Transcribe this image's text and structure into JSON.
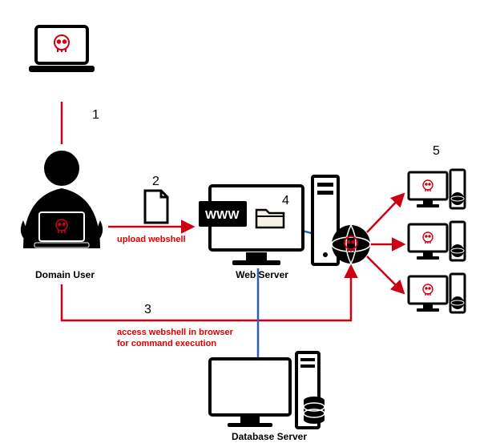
{
  "steps": {
    "s1": "1",
    "s2": "2",
    "s3": "3",
    "s4": "4",
    "s5": "5"
  },
  "nodes": {
    "domain_user": "Domain User",
    "web_server": "Web Server",
    "database_server": "Database Server",
    "www": "WWW"
  },
  "annotations": {
    "upload": "upload webshell",
    "access_l1": "access webshell in browser",
    "access_l2": "for command execution"
  },
  "colors": {
    "red": "#cc0011",
    "black": "#000000",
    "blue": "#2a5fb4"
  }
}
